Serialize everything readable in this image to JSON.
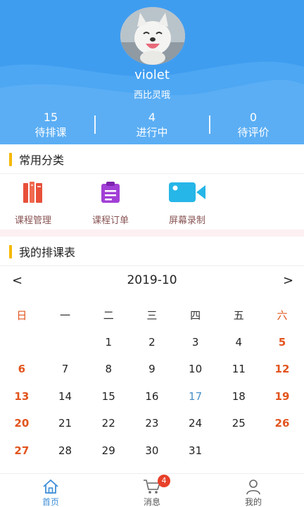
{
  "profile": {
    "username": "violet",
    "subtitle": "西比灵哦"
  },
  "stats": [
    {
      "value": "15",
      "label": "待排课"
    },
    {
      "value": "4",
      "label": "进行中"
    },
    {
      "value": "0",
      "label": "待评价"
    }
  ],
  "categories": {
    "title": "常用分类",
    "items": [
      {
        "label": "课程管理",
        "icon": "books-icon"
      },
      {
        "label": "课程订单",
        "icon": "clipboard-icon"
      },
      {
        "label": "屏幕录制",
        "icon": "video-camera-icon"
      }
    ]
  },
  "schedule": {
    "title": "我的排课表",
    "month": "2019-10",
    "prev": "<",
    "next": ">",
    "weekdays": [
      "日",
      "一",
      "二",
      "三",
      "四",
      "五",
      "六"
    ],
    "weeks": [
      [
        "",
        "",
        "1",
        "2",
        "3",
        "4",
        "5"
      ],
      [
        "6",
        "7",
        "8",
        "9",
        "10",
        "11",
        "12"
      ],
      [
        "13",
        "14",
        "15",
        "16",
        "17",
        "18",
        "19"
      ],
      [
        "20",
        "21",
        "22",
        "23",
        "24",
        "25",
        "26"
      ],
      [
        "27",
        "28",
        "29",
        "30",
        "31",
        "",
        ""
      ]
    ],
    "highlight_day": "17"
  },
  "tabbar": {
    "items": [
      {
        "label": "首页",
        "icon": "home-icon",
        "active": true
      },
      {
        "label": "消息",
        "icon": "cart-icon",
        "badge": "4"
      },
      {
        "label": "我的",
        "icon": "user-icon"
      }
    ]
  },
  "colors": {
    "header_blue": "#3f9df0",
    "accent_yellow": "#f5b800",
    "weekend_red": "#e2541d",
    "today_blue": "#4a90c8",
    "tab_active": "#3f8fd8"
  }
}
